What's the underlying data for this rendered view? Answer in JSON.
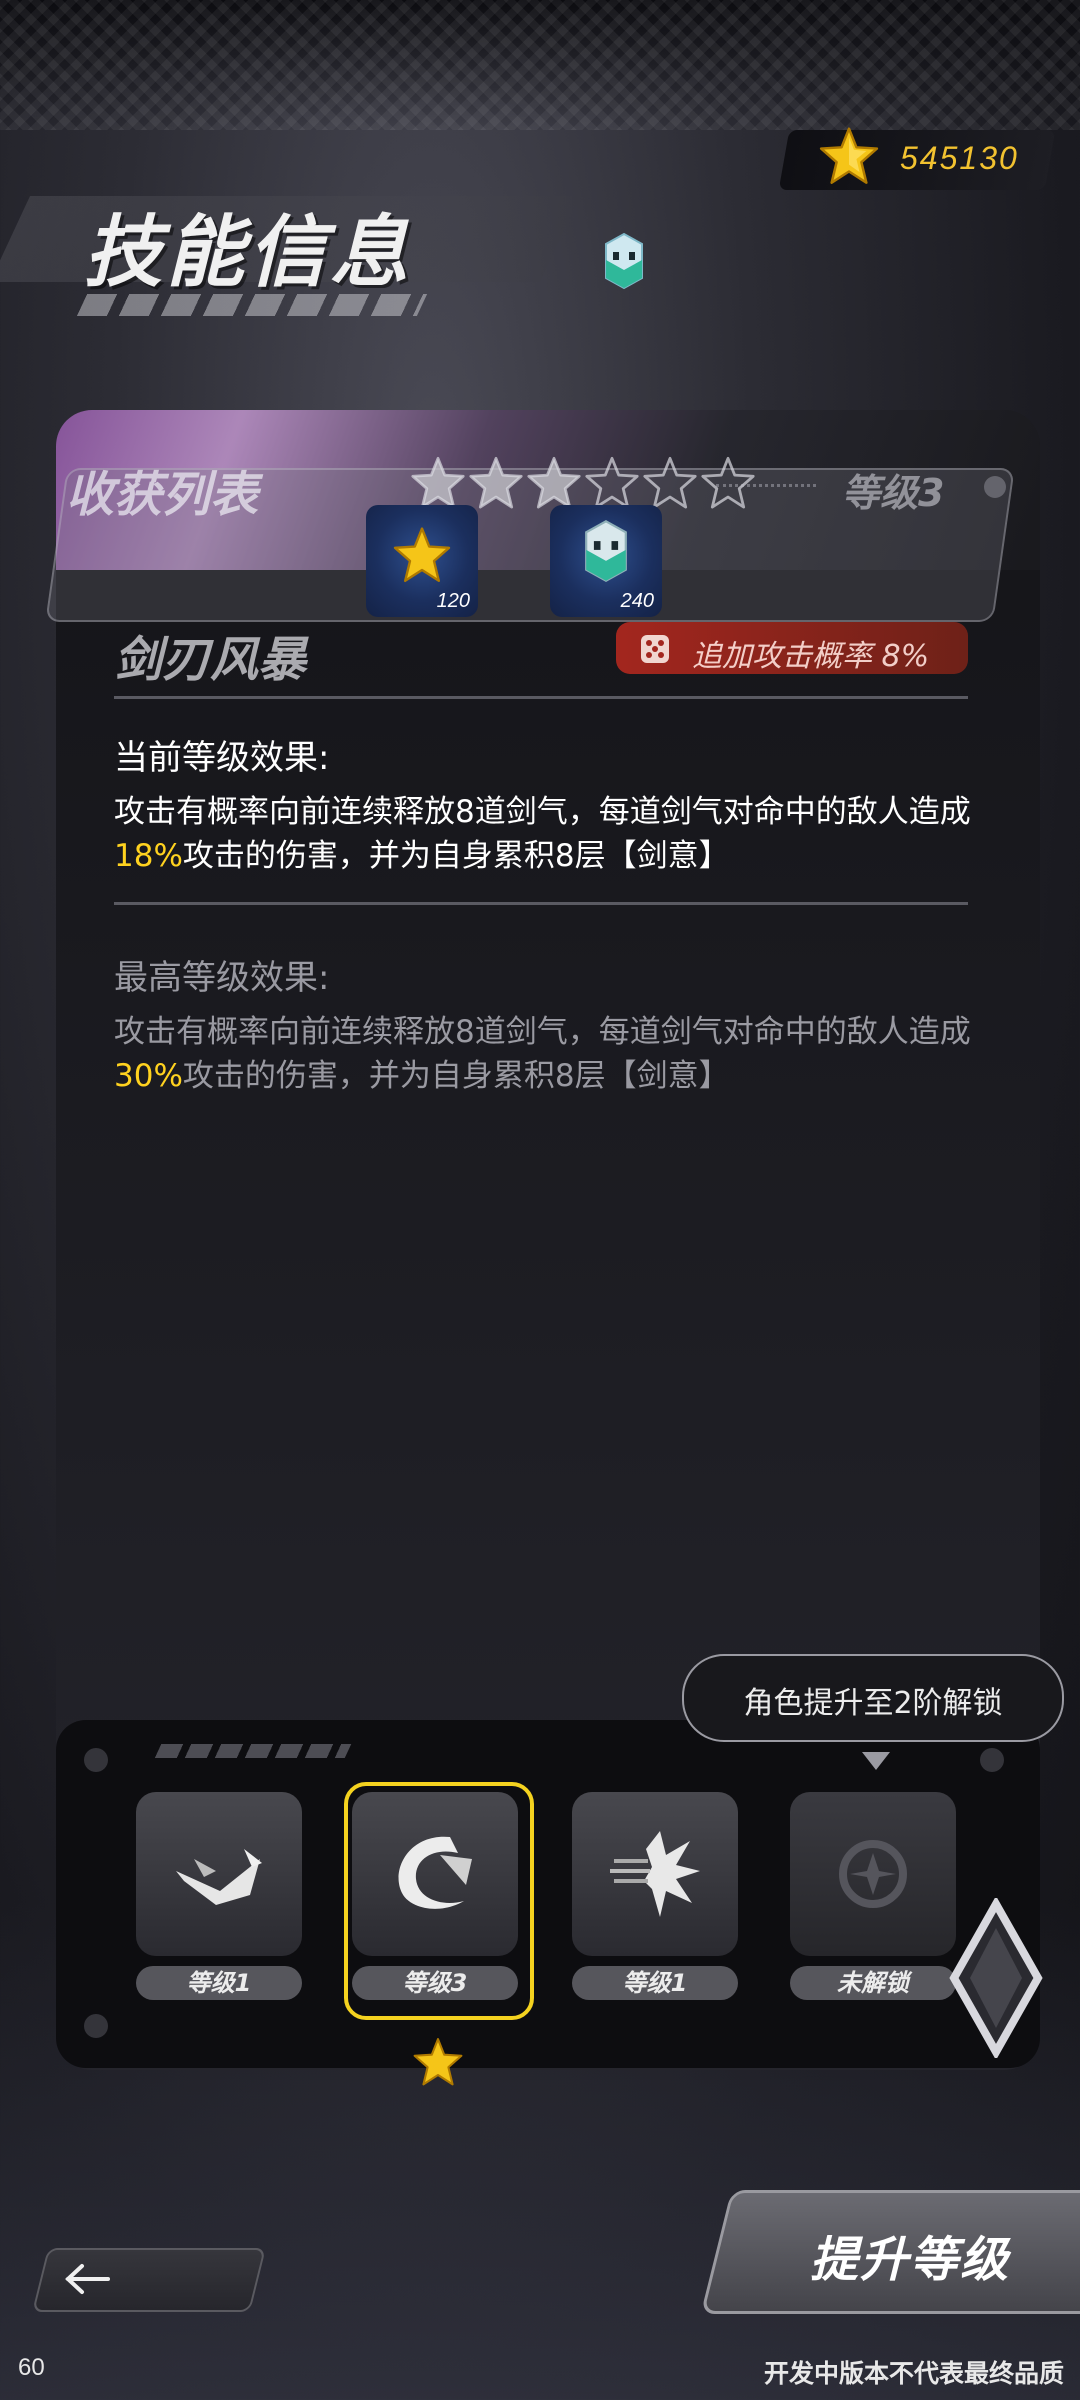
{
  "header": {
    "title": "技能信息",
    "currency": {
      "icon": "star-icon",
      "value": "545130"
    },
    "cube_icon": "cube-icon"
  },
  "harvest": {
    "label": "收获列表",
    "stars_total": 6,
    "stars_filled": 3,
    "level_label": "等级3",
    "rewards": [
      {
        "icon": "star-icon",
        "qty": "120"
      },
      {
        "icon": "cube-icon",
        "qty": "240"
      }
    ]
  },
  "skill": {
    "name": "剑刃风暴",
    "bonus": "追加攻击概率 8%",
    "current": {
      "heading": "当前等级效果:",
      "text_before": "攻击有概率向前连续释放8道剑气，每道剑气对命中的敌人造成",
      "highlight": "18%",
      "text_after": "攻击的伤害，并为自身累积8层【剑意】"
    },
    "max": {
      "heading": "最高等级效果:",
      "text_before": "攻击有概率向前连续释放8道剑气，每道剑气对命中的敌人造成",
      "highlight": "30%",
      "text_after": "攻击的伤害，并为自身累积8层【剑意】"
    }
  },
  "unlock_hint": "角色提升至2阶解锁",
  "skill_slots": [
    {
      "label": "等级1",
      "icon": "blade-icon"
    },
    {
      "label": "等级3",
      "icon": "crescent-icon",
      "selected": true
    },
    {
      "label": "等级1",
      "icon": "burst-icon"
    },
    {
      "label": "未解锁",
      "icon": "locked-emblem-icon"
    }
  ],
  "buttons": {
    "upgrade": "提升等级",
    "back_icon": "back-arrow-icon"
  },
  "footer": {
    "fps": "60",
    "note": "开发中版本不代表最终品质"
  },
  "colors": {
    "accent": "#ffd21f",
    "bonus_bg": "#a3261e",
    "gold": "#f2c230"
  }
}
